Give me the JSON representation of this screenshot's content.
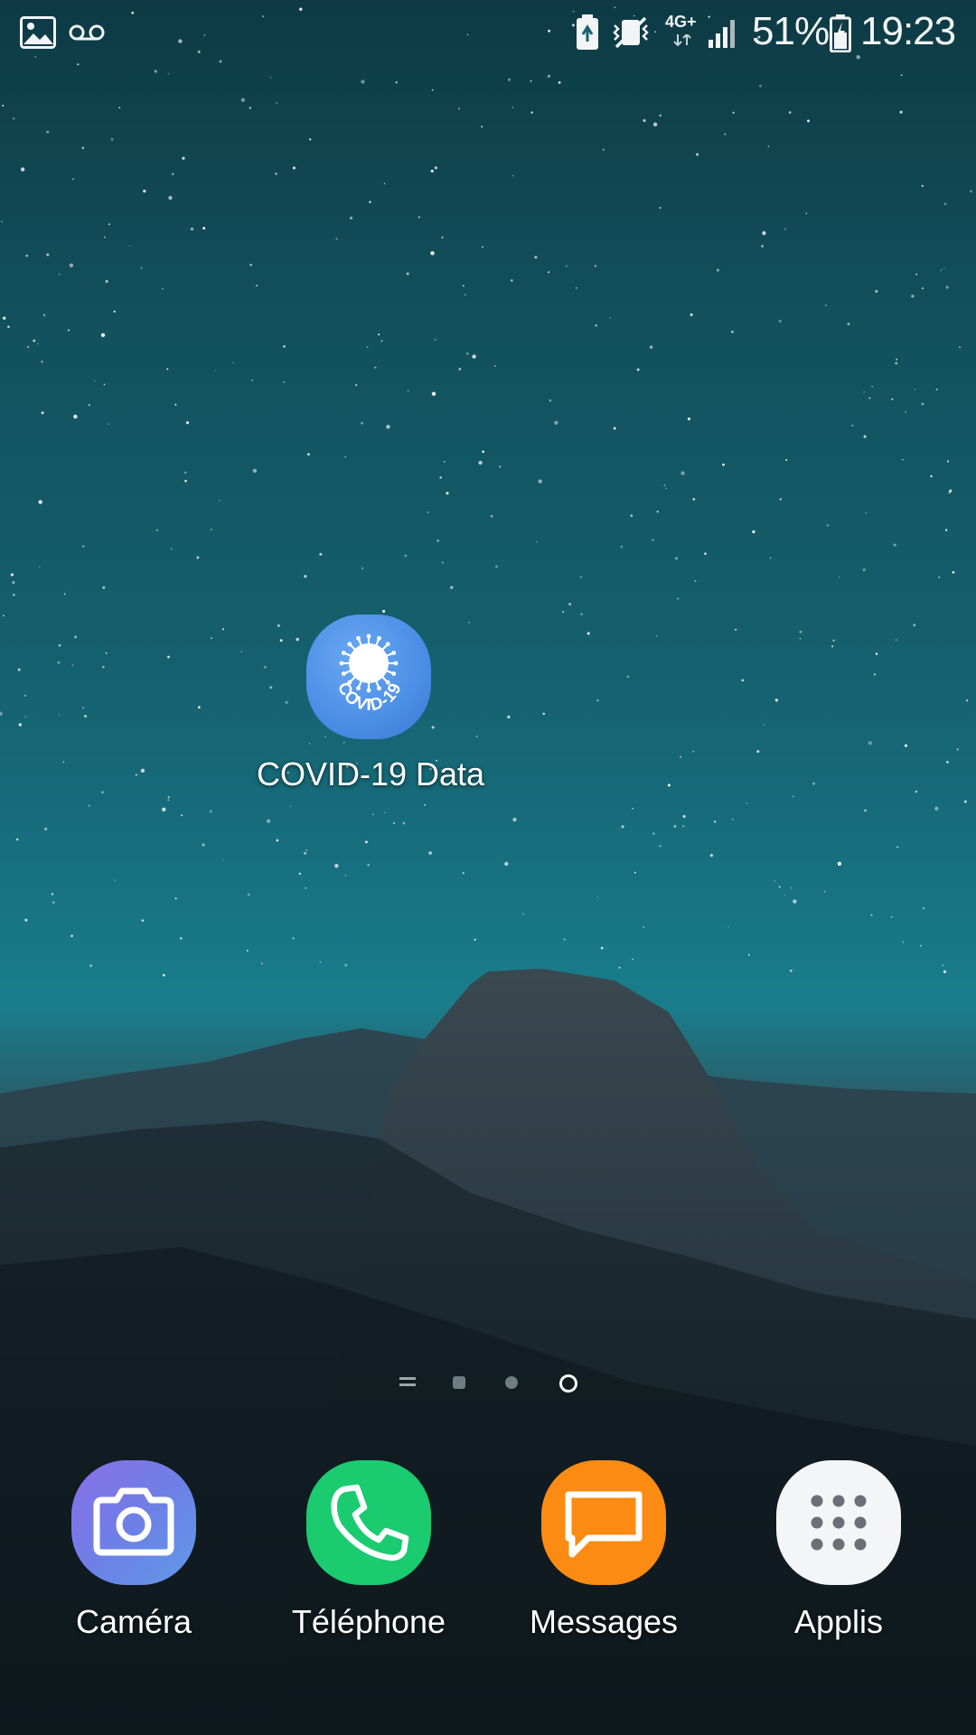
{
  "status_bar": {
    "network_type": "4G+",
    "battery_percent": "51%",
    "time": "19:23",
    "icons": [
      "gallery-icon",
      "voicemail-icon",
      "battery-saver-icon",
      "vibrate-mute-icon",
      "network-4g-icon",
      "signal-icon",
      "battery-icon"
    ]
  },
  "home": {
    "apps": [
      {
        "label": "COVID-19 Data",
        "icon": "covid-virus-icon",
        "icon_text": "COVID-19",
        "color": "#4a8ee6"
      }
    ]
  },
  "page_indicator": {
    "pages": 4,
    "current_page": 4
  },
  "dock": {
    "apps": [
      {
        "label": "Caméra",
        "icon": "camera-icon",
        "color": "#7a78e8"
      },
      {
        "label": "Téléphone",
        "icon": "phone-icon",
        "color": "#1bcb70"
      },
      {
        "label": "Messages",
        "icon": "message-icon",
        "color": "#fb8b12"
      },
      {
        "label": "Applis",
        "icon": "apps-grid-icon",
        "color": "#f4f5f7"
      }
    ]
  }
}
